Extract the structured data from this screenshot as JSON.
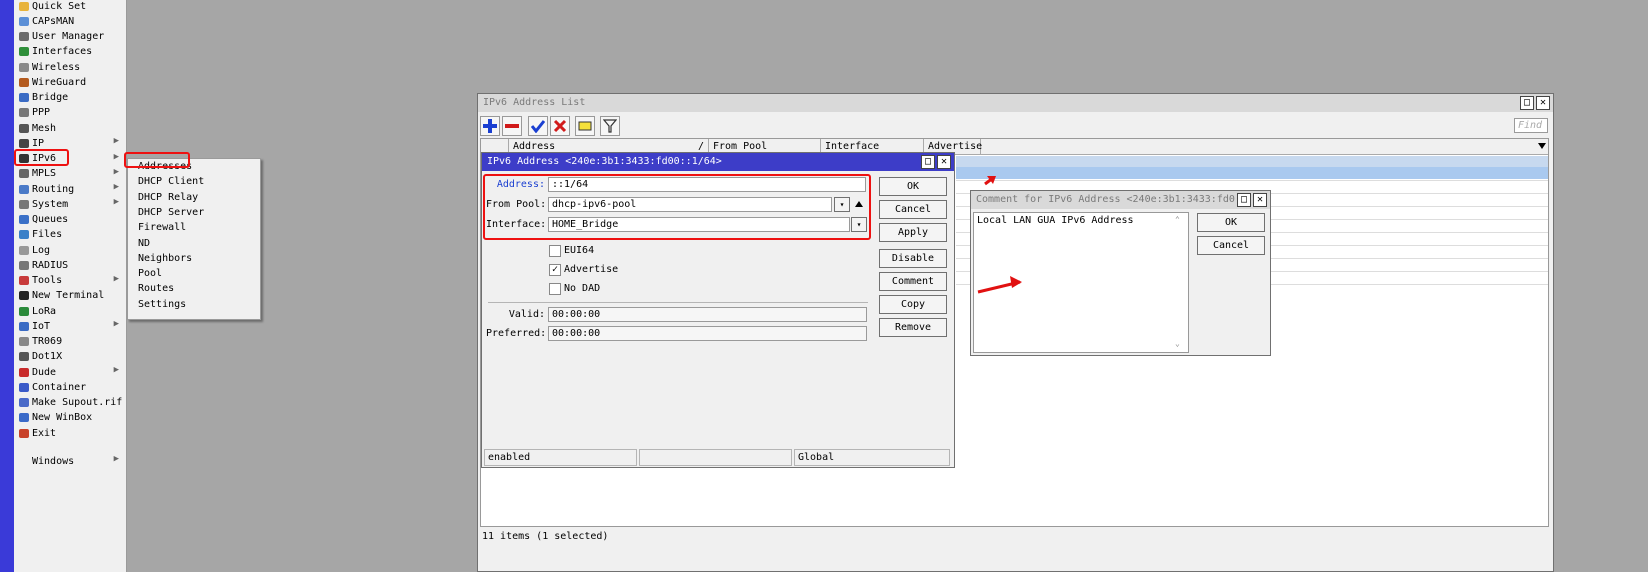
{
  "menu": {
    "items": [
      {
        "label": "Quick Set",
        "icon": "quick-set-icon",
        "arrow": ""
      },
      {
        "label": "CAPsMAN",
        "icon": "capsman-icon",
        "arrow": ""
      },
      {
        "label": "User Manager",
        "icon": "user-manager-icon",
        "arrow": ""
      },
      {
        "label": "Interfaces",
        "icon": "interfaces-icon",
        "arrow": ""
      },
      {
        "label": "Wireless",
        "icon": "wireless-icon",
        "arrow": ""
      },
      {
        "label": "WireGuard",
        "icon": "wireguard-icon",
        "arrow": ""
      },
      {
        "label": "Bridge",
        "icon": "bridge-icon",
        "arrow": ""
      },
      {
        "label": "PPP",
        "icon": "ppp-icon",
        "arrow": ""
      },
      {
        "label": "Mesh",
        "icon": "mesh-icon",
        "arrow": ""
      },
      {
        "label": "IP",
        "icon": "ip-icon",
        "arrow": "▶"
      },
      {
        "label": "IPv6",
        "icon": "ipv6-icon",
        "arrow": "▶"
      },
      {
        "label": "MPLS",
        "icon": "mpls-icon",
        "arrow": "▶"
      },
      {
        "label": "Routing",
        "icon": "routing-icon",
        "arrow": "▶"
      },
      {
        "label": "System",
        "icon": "system-icon",
        "arrow": "▶"
      },
      {
        "label": "Queues",
        "icon": "queues-icon",
        "arrow": ""
      },
      {
        "label": "Files",
        "icon": "files-icon",
        "arrow": ""
      },
      {
        "label": "Log",
        "icon": "log-icon",
        "arrow": ""
      },
      {
        "label": "RADIUS",
        "icon": "radius-icon",
        "arrow": ""
      },
      {
        "label": "Tools",
        "icon": "tools-icon",
        "arrow": "▶"
      },
      {
        "label": "New Terminal",
        "icon": "terminal-icon",
        "arrow": ""
      },
      {
        "label": "LoRa",
        "icon": "lora-icon",
        "arrow": ""
      },
      {
        "label": "IoT",
        "icon": "iot-icon",
        "arrow": "▶"
      },
      {
        "label": "TR069",
        "icon": "tr069-icon",
        "arrow": ""
      },
      {
        "label": "Dot1X",
        "icon": "dot1x-icon",
        "arrow": ""
      },
      {
        "label": "Dude",
        "icon": "dude-icon",
        "arrow": "▶"
      },
      {
        "label": "Container",
        "icon": "container-icon",
        "arrow": ""
      },
      {
        "label": "Make Supout.rif",
        "icon": "supout-icon",
        "arrow": ""
      },
      {
        "label": "New WinBox",
        "icon": "winbox-icon",
        "arrow": ""
      },
      {
        "label": "Exit",
        "icon": "exit-icon",
        "arrow": ""
      }
    ],
    "windows": {
      "label": "Windows",
      "arrow": "▶"
    }
  },
  "ipv6_submenu": [
    "Addresses",
    "DHCP Client",
    "DHCP Relay",
    "DHCP Server",
    "Firewall",
    "ND",
    "Neighbors",
    "Pool",
    "Routes",
    "Settings"
  ],
  "list_window": {
    "title": "IPv6 Address List",
    "find_placeholder": "Find",
    "columns": [
      "Address",
      "/",
      "From Pool",
      "Interface",
      "Advertise"
    ],
    "status": "11 items (1 selected)"
  },
  "edit_dialog": {
    "title": "IPv6 Address <240e:3b1:3433:fd00::1/64>",
    "address_label": "Address:",
    "address_value": "::1/64",
    "pool_label": "From Pool:",
    "pool_value": "dhcp-ipv6-pool",
    "interface_label": "Interface:",
    "interface_value": "HOME_Bridge",
    "eui64_label": "EUI64",
    "eui64_checked": false,
    "advertise_label": "Advertise",
    "advertise_checked": true,
    "nodad_label": "No DAD",
    "nodad_checked": false,
    "valid_label": "Valid:",
    "valid_value": "00:00:00",
    "preferred_label": "Preferred:",
    "preferred_value": "00:00:00",
    "buttons": {
      "ok": "OK",
      "cancel": "Cancel",
      "apply": "Apply",
      "disable": "Disable",
      "comment": "Comment",
      "copy": "Copy",
      "remove": "Remove"
    },
    "status_left": "enabled",
    "status_mid": "",
    "status_right": "Global"
  },
  "comment_dialog": {
    "title": "Comment for IPv6 Address <240e:3b1:3433:fd0...",
    "text": "Local LAN GUA IPv6 Address",
    "ok": "OK",
    "cancel": "Cancel"
  },
  "colors": {
    "accent_red": "#e11111",
    "title_active": "#3d3dc8",
    "selection": "#a9c9ef"
  }
}
